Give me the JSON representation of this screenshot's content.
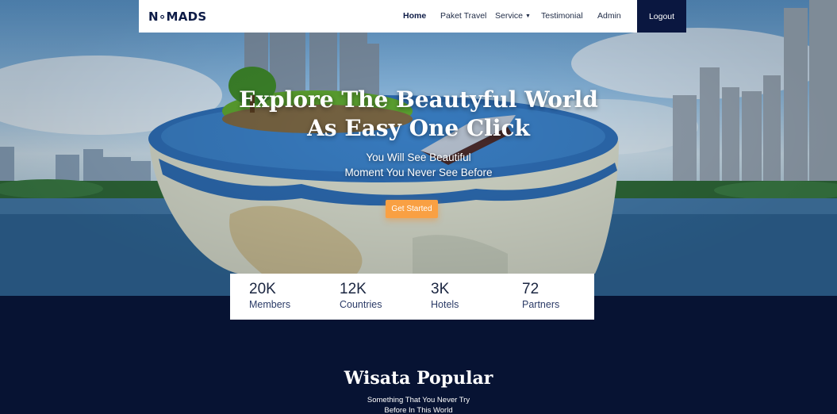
{
  "navbar": {
    "brand": "N∘MADS",
    "links": [
      {
        "label": "Home",
        "active": true
      },
      {
        "label": "Paket Travel"
      },
      {
        "label": "Service"
      },
      {
        "label": "Testimonial"
      },
      {
        "label": "Admin"
      }
    ],
    "logout_label": "Logout"
  },
  "hero": {
    "title_line1": "Explore The Beautyful World",
    "title_line2": "As Easy One Click",
    "subtitle_line1": "You Will See Beautiful",
    "subtitle_line2": "Moment You Never See Before",
    "cta_label": "Get Started",
    "cta_color": "#f9a043"
  },
  "stats": [
    {
      "value": "20K",
      "label": "Members"
    },
    {
      "value": "12K",
      "label": "Countries"
    },
    {
      "value": "3K",
      "label": "Hotels"
    },
    {
      "value": "72",
      "label": "Partners"
    }
  ],
  "popular": {
    "title": "Wisata Popular",
    "subtitle_line1": "Something That You Never Try",
    "subtitle_line2": "Before In This World"
  },
  "colors": {
    "navy": "#071333",
    "accent": "#f9a043",
    "navbar_bg": "#ffffff"
  },
  "icons": [
    "dropdown-caret-icon"
  ]
}
